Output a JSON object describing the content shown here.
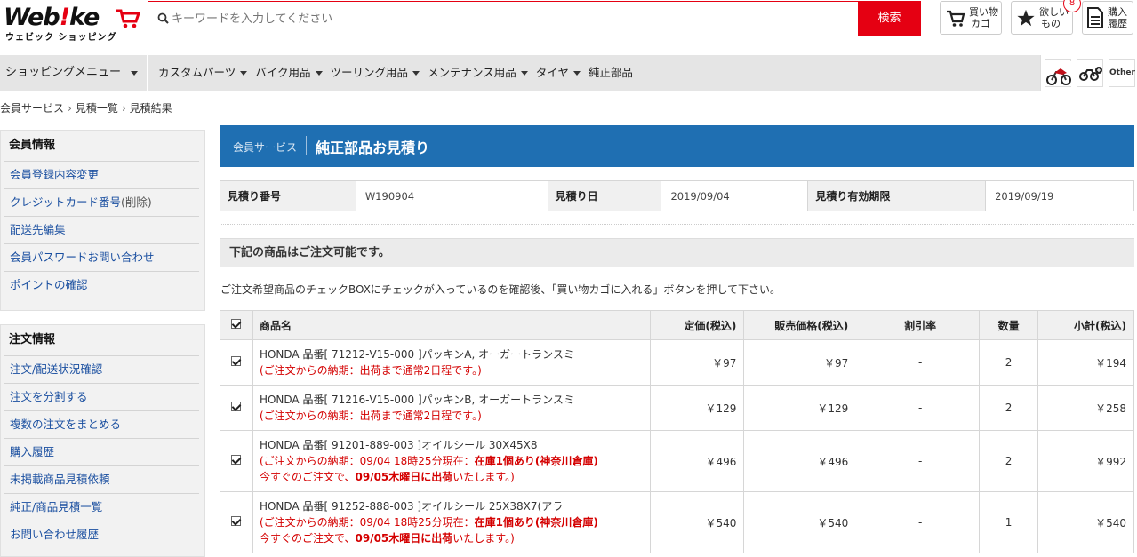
{
  "header": {
    "logo_text_a": "Web",
    "logo_text_bang": "!",
    "logo_text_b": "ke",
    "logo_sub": "ウェビック ショッピング",
    "search_placeholder": "キーワードを入力してください",
    "search_button": "検索",
    "cart_label_1": "買い物",
    "cart_label_2": "カゴ",
    "wish_label_1": "欲しい",
    "wish_label_2": "もの",
    "wish_count": "8",
    "history_label_1": "購入",
    "history_label_2": "履歴"
  },
  "nav": {
    "shopping_menu": "ショッピングメニュー",
    "items": [
      "カスタムパーツ",
      "バイク用品",
      "ツーリング用品",
      "メンテナンス用品",
      "タイヤ",
      "純正部品"
    ],
    "other_label": "Other"
  },
  "breadcrumb": [
    "会員サービス",
    "見積一覧",
    "見積結果"
  ],
  "sidebar": {
    "member": {
      "title": "会員情報",
      "links": [
        "会員登録内容変更",
        "クレジットカード番号",
        "配送先編集",
        "会員パスワードお問い合わせ",
        "ポイントの確認"
      ],
      "credit_suffix": "(削除)"
    },
    "order": {
      "title": "注文情報",
      "links": [
        "注文/配送状況確認",
        "注文を分割する",
        "複数の注文をまとめる",
        "購入履歴",
        "未掲載商品見積依頼",
        "純正/商品見積一覧",
        "お問い合わせ履歴"
      ]
    }
  },
  "main": {
    "section_label": "会員サービス",
    "page_title": "純正部品お見積り",
    "info": {
      "number_label": "見積り番号",
      "number_value": "W190904",
      "date_label": "見積り日",
      "date_value": "2019/09/04",
      "expiry_label": "見積り有効期限",
      "expiry_value": "2019/09/19"
    },
    "available_heading": "下記の商品はご注文可能です。",
    "instruction": "ご注文希望商品のチェックBOXにチェックが入っているのを確認後、「買い物カゴに入れる」ボタンを押して下さい。",
    "table": {
      "headers": [
        "商品名",
        "定価(税込)",
        "販売価格(税込)",
        "割引率",
        "数量",
        "小計(税込)"
      ],
      "rows": [
        {
          "name": "HONDA 品番[ 71212-V15-000 ]パッキンA, オーガートランスミ",
          "note1_a": "(ご注文からの納期：出荷まで通常2日程です。)",
          "note1_b": "",
          "note2_a": "",
          "note2_b": "",
          "list_price": "￥97",
          "sale_price": "￥97",
          "discount": "-",
          "qty": "2",
          "subtotal": "￥194"
        },
        {
          "name": "HONDA 品番[ 71216-V15-000 ]パッキンB, オーガートランスミ",
          "note1_a": "(ご注文からの納期：出荷まで通常2日程です。)",
          "note1_b": "",
          "note2_a": "",
          "note2_b": "",
          "list_price": "￥129",
          "sale_price": "￥129",
          "discount": "-",
          "qty": "2",
          "subtotal": "￥258"
        },
        {
          "name": "HONDA 品番[ 91201-889-003 ]オイルシール 30X45X8",
          "note1_a": "(ご注文からの納期：09/04 18時25分現在：",
          "note1_b": "在庫1個あり(神奈川倉庫)",
          "note2_a": "今すぐのご注文で、",
          "note2_b": "09/05木曜日に出荷",
          "note2_c": "いたします。)",
          "list_price": "￥496",
          "sale_price": "￥496",
          "discount": "-",
          "qty": "2",
          "subtotal": "￥992"
        },
        {
          "name": "HONDA 品番[ 91252-888-003 ]オイルシール 25X38X7(アラ",
          "note1_a": "(ご注文からの納期：09/04 18時25分現在：",
          "note1_b": "在庫1個あり(神奈川倉庫)",
          "note2_a": "今すぐのご注文で、",
          "note2_b": "09/05木曜日に出荷",
          "note2_c": "いたします。)",
          "list_price": "￥540",
          "sale_price": "￥540",
          "discount": "-",
          "qty": "1",
          "subtotal": "￥540"
        }
      ]
    }
  }
}
